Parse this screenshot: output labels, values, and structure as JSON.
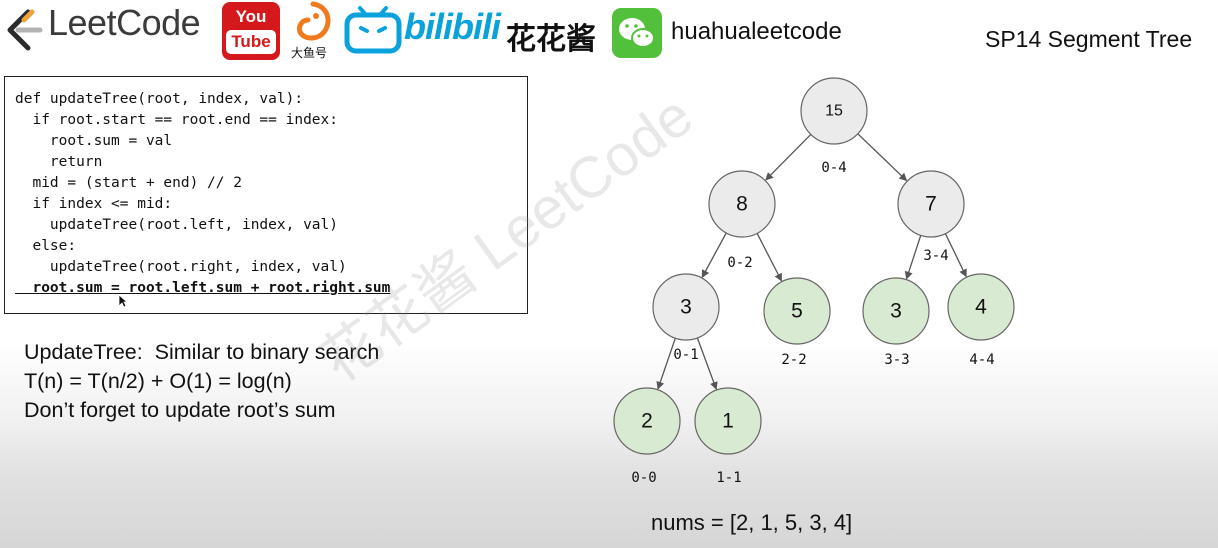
{
  "header": {
    "brand": "LeetCode",
    "youtube_you": "You",
    "youtube_tube": "Tube",
    "douyu": "大鱼号",
    "bilibili": "bilibili",
    "channel_cn": "花花酱",
    "wechat_name": "huahualeetcode",
    "slide_title": "SP14 Segment Tree",
    "colors": {
      "youtube": "#d4181c",
      "bilibili": "#0aa2dd",
      "wechat": "#52c03a",
      "douyu": "#f07a1e"
    }
  },
  "code": {
    "lines": [
      "def updateTree(root, index, val):",
      "  if root.start == root.end == index:",
      "    root.sum = val",
      "    return",
      "  mid = (start + end) // 2",
      "  if index <= mid:",
      "    updateTree(root.left, index, val)",
      "  else:",
      "    updateTree(root.right, index, val)",
      "  root.sum = root.left.sum + root.right.sum"
    ]
  },
  "notes": [
    "UpdateTree:  Similar to binary search",
    "T(n) = T(n/2) + O(1) = log(n)",
    "Don’t forget to update root’s sum"
  ],
  "tree": {
    "nodes": [
      {
        "value": "15",
        "range": "0-4",
        "highlight": false
      },
      {
        "value": "8",
        "range": "0-2",
        "highlight": false
      },
      {
        "value": "7",
        "range": "3-4",
        "highlight": false
      },
      {
        "value": "3",
        "range": "0-1",
        "highlight": false
      },
      {
        "value": "5",
        "range": "2-2",
        "highlight": true
      },
      {
        "value": "3",
        "range": "3-3",
        "highlight": true
      },
      {
        "value": "4",
        "range": "4-4",
        "highlight": true
      },
      {
        "value": "2",
        "range": "0-0",
        "highlight": true
      },
      {
        "value": "1",
        "range": "1-1",
        "highlight": true
      }
    ],
    "edges": [
      [
        0,
        1
      ],
      [
        0,
        2
      ],
      [
        1,
        3
      ],
      [
        1,
        4
      ],
      [
        2,
        5
      ],
      [
        2,
        6
      ],
      [
        3,
        7
      ],
      [
        3,
        8
      ]
    ],
    "colors": {
      "internal": "#ebebeb",
      "leaf": "#d9ead3",
      "stroke": "#666666"
    }
  },
  "nums_label": "nums = [2, 1, 5, 3, 4]",
  "watermark": "花花酱 LeetCode"
}
